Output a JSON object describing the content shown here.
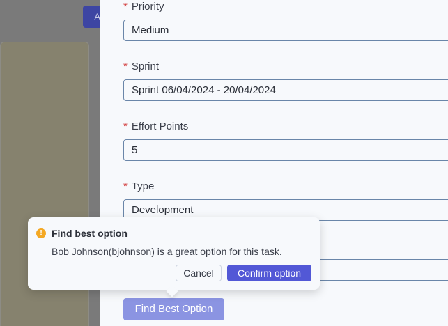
{
  "background": {
    "button_label": "A"
  },
  "form": {
    "priority": {
      "label": "Priority",
      "value": "Medium"
    },
    "sprint": {
      "label": "Sprint",
      "value": "Sprint 06/04/2024 - 20/04/2024"
    },
    "effort": {
      "label": "Effort Points",
      "value": "5"
    },
    "type": {
      "label": "Type",
      "value": "Development"
    },
    "find_button": "Find Best Option"
  },
  "popconfirm": {
    "icon": "warning-icon",
    "icon_glyph": "!",
    "title": "Find best option",
    "description": "Bob Johnson(bjohnson) is a great option for this task.",
    "cancel": "Cancel",
    "confirm": "Confirm option"
  },
  "colors": {
    "accent": "#5258d6",
    "accent_light": "#8b94e2",
    "required": "#d23b3b",
    "warning": "#f4a823"
  }
}
